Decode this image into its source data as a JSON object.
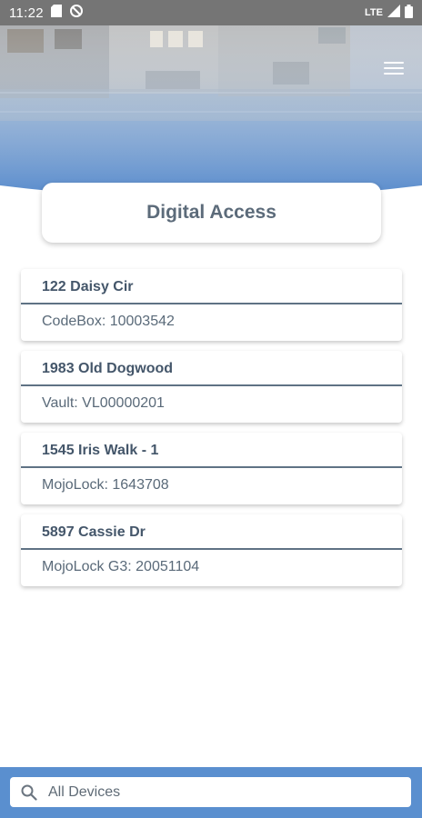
{
  "status_bar": {
    "time": "11:22",
    "network": "LTE",
    "icons": [
      "sd-card-icon",
      "data-saver-icon",
      "signal-icon",
      "battery-icon"
    ]
  },
  "header": {
    "menu_icon": "hamburger-menu-icon",
    "title": "Digital Access"
  },
  "devices": [
    {
      "address": "122 Daisy Cir",
      "detail": "CodeBox: 10003542"
    },
    {
      "address": "1983 Old Dogwood",
      "detail": "Vault: VL00000201"
    },
    {
      "address": "1545 Iris Walk - 1",
      "detail": "MojoLock: 1643708"
    },
    {
      "address": "5897 Cassie Dr",
      "detail": "MojoLock G3: 20051104"
    }
  ],
  "search": {
    "placeholder": "All Devices",
    "icon": "search-icon"
  },
  "colors": {
    "accent": "#5a8fcf",
    "status_bar": "#757575",
    "text_dark": "#44566a"
  }
}
